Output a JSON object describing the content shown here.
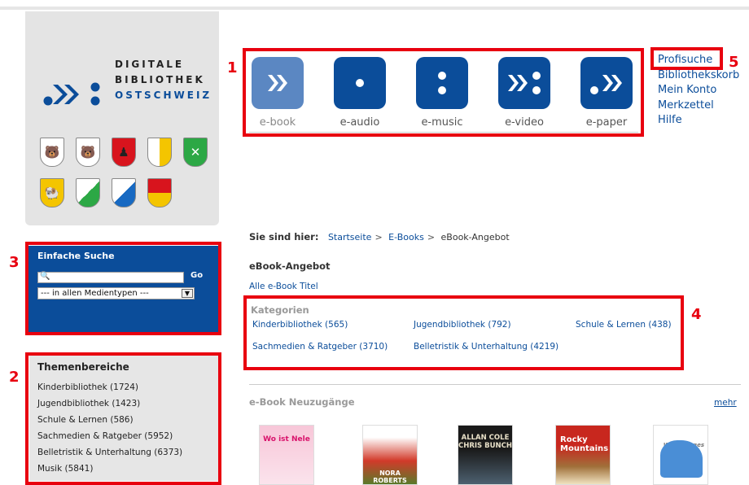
{
  "logo": {
    "line1": "DIGITALE",
    "line2": "BIBLIOTHEK",
    "line3": "OSTSCHWEIZ",
    "colors": {
      "blue": "#0b4d9a"
    }
  },
  "media_tabs": [
    {
      "label": "e-book",
      "icon": "double-chevron-icon",
      "active": true
    },
    {
      "label": "e-audio",
      "icon": "single-dot-icon",
      "active": false
    },
    {
      "label": "e-music",
      "icon": "two-dots-icon",
      "active": false
    },
    {
      "label": "e-video",
      "icon": "chevrons-dots-icon",
      "active": false
    },
    {
      "label": "e-paper",
      "icon": "dot-chevrons-icon",
      "active": false
    }
  ],
  "top_links": [
    "Profisuche",
    "Bibliothekskorb",
    "Mein Konto",
    "Merkzettel",
    "Hilfe"
  ],
  "annotations": [
    "1",
    "2",
    "3",
    "4",
    "5"
  ],
  "search": {
    "title": "Einfache Suche",
    "go_label": "Go",
    "select_value": "--- in allen Medientypen ---"
  },
  "themen": {
    "title": "Themenbereiche",
    "items": [
      "Kinderbibliothek (1724)",
      "Jugendbibliothek (1423)",
      "Schule & Lernen (586)",
      "Sachmedien & Ratgeber (5952)",
      "Belletristik & Unterhaltung (6373)",
      "Musik (5841)"
    ]
  },
  "breadcrumb": {
    "prefix": "Sie sind hier:",
    "items": [
      "Startseite",
      "E-Books",
      "eBook-Angebot"
    ],
    "sep": ">"
  },
  "page_title": "eBook-Angebot",
  "all_titles_link": "Alle e-Book Titel",
  "kategorien": {
    "title": "Kategorien",
    "items": [
      "Kinderbibliothek (565)",
      "Jugendbibliothek (792)",
      "Schule & Lernen (438)",
      "Sachmedien & Ratgeber (3710)",
      "Belletristik & Unterhaltung (4219)"
    ]
  },
  "neuzugaenge": {
    "title": "e-Book Neuzugänge",
    "more_link": "mehr",
    "covers": [
      {
        "text": "Wo ist Nele"
      },
      {
        "text": "NORA ROBERTS"
      },
      {
        "text": "ALLAN COLE CHRIS BUNCH"
      },
      {
        "text": "Rocky Mountains"
      },
      {
        "text": "Wendy Jages"
      }
    ]
  }
}
